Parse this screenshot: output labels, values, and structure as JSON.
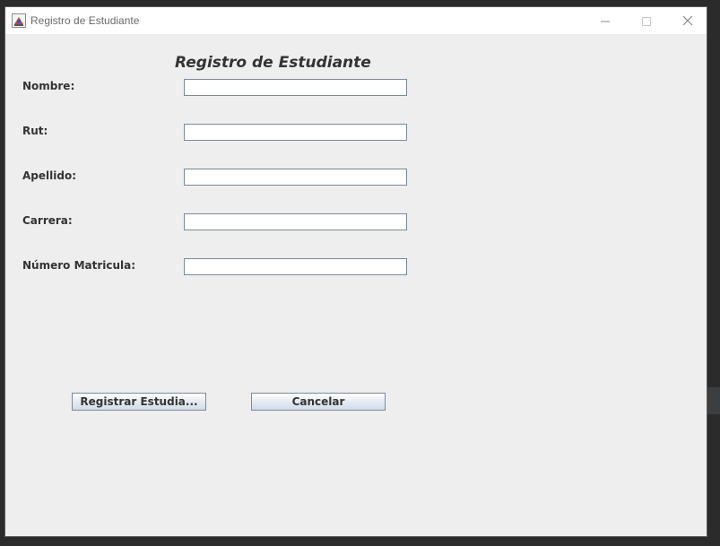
{
  "window": {
    "title": "Registro de Estudiante"
  },
  "form": {
    "heading": "Registro de Estudiante",
    "fields": [
      {
        "label": "Nombre:",
        "value": ""
      },
      {
        "label": "Rut:",
        "value": ""
      },
      {
        "label": "Apellido:",
        "value": ""
      },
      {
        "label": "Carrera:",
        "value": ""
      },
      {
        "label": "Número Matricula:",
        "value": ""
      }
    ],
    "buttons": {
      "register": "Registrar Estudia...",
      "cancel": "Cancelar"
    }
  },
  "icons": [
    "java-app-icon",
    "minimize-icon",
    "maximize-icon",
    "close-icon"
  ]
}
